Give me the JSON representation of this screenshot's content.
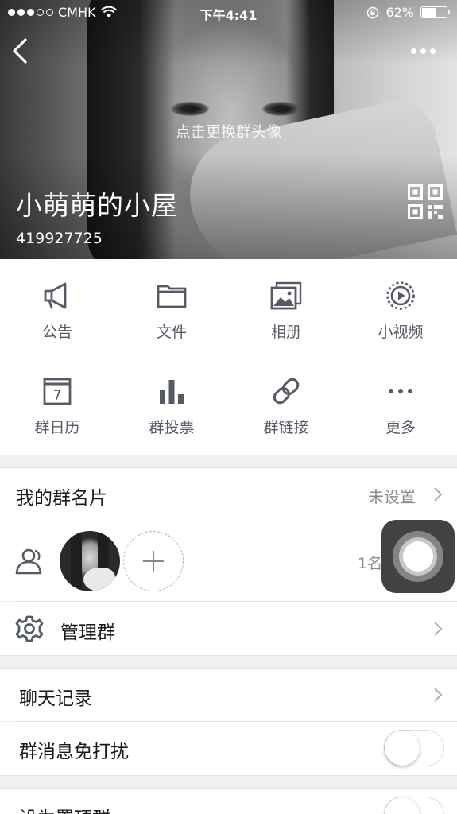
{
  "status_bar": {
    "carrier": "CMHK",
    "time": "下午4:41",
    "battery_text": "62%",
    "battery_level": 0.62
  },
  "header": {
    "avatar_hint": "点击更换群头像",
    "group_name": "小萌萌的小屋",
    "group_id": "419927725"
  },
  "features": [
    {
      "label": "公告",
      "icon": "megaphone-icon"
    },
    {
      "label": "文件",
      "icon": "folder-icon"
    },
    {
      "label": "相册",
      "icon": "photo-album-icon"
    },
    {
      "label": "小视频",
      "icon": "video-icon"
    },
    {
      "label": "群日历",
      "icon": "calendar-icon",
      "day": "7"
    },
    {
      "label": "群投票",
      "icon": "bar-chart-icon"
    },
    {
      "label": "群链接",
      "icon": "link-icon"
    },
    {
      "label": "更多",
      "icon": "more-icon"
    }
  ],
  "card": {
    "title": "我的群名片",
    "value": "未设置"
  },
  "members": {
    "count_text": "1名"
  },
  "manage": {
    "title": "管理群"
  },
  "settings": [
    {
      "title": "聊天记录",
      "type": "link"
    },
    {
      "title": "群消息免打扰",
      "type": "toggle",
      "on": false
    },
    {
      "title": "设为置顶群",
      "type": "toggle",
      "on": false
    }
  ],
  "colors": {
    "icon": "#555a66",
    "label": "#555a66",
    "background": "#f0f0f2"
  }
}
